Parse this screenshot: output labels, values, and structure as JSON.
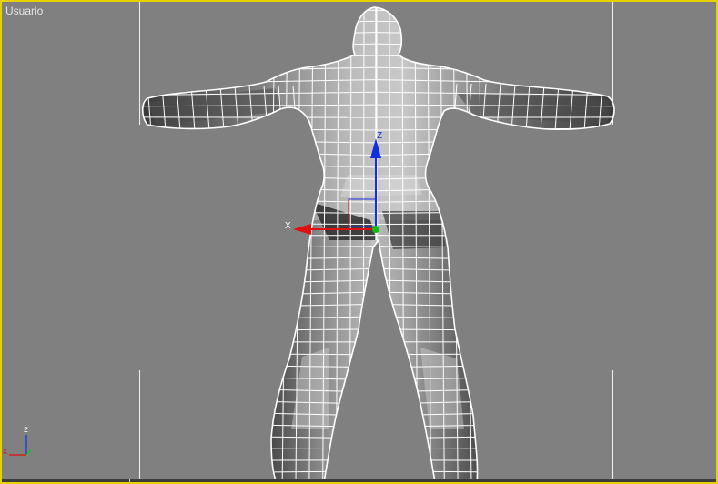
{
  "viewport": {
    "label": "Usuario",
    "border_color": "#e8d100",
    "background_color": "#808080"
  },
  "model": {
    "type": "humanoid-wireframe-mesh",
    "view": "back",
    "shading": "smooth-with-edged-faces",
    "wire_color": "#ffffff"
  },
  "transform_gizmo": {
    "x_label": "X",
    "z_label": "Z",
    "x_color": "#e01010",
    "y_color": "#10c010",
    "z_color": "#1030e0"
  },
  "view_axis_tripod": {
    "x_label": "x",
    "z_label": "z",
    "x_color": "#d02020",
    "y_color": "#20c020",
    "z_color": "#2040d0"
  }
}
